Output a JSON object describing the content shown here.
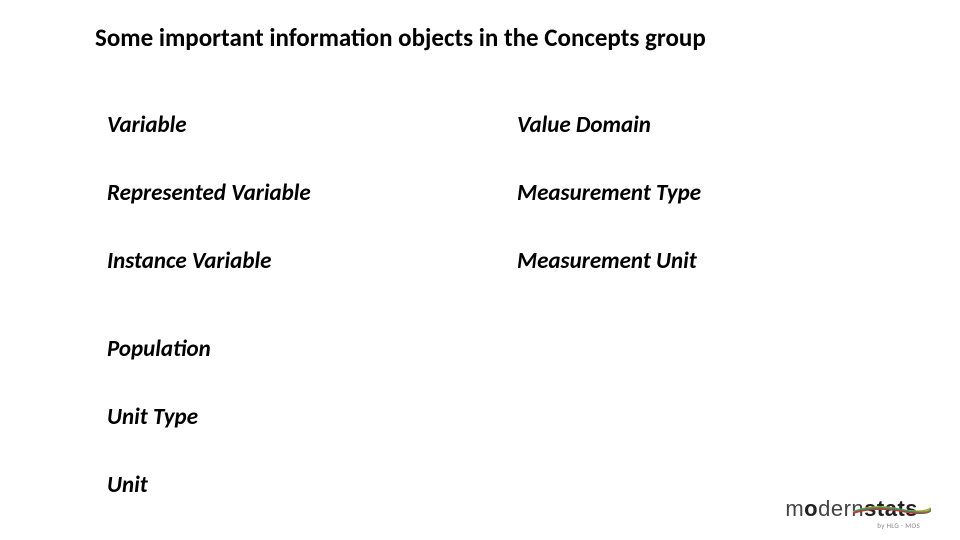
{
  "title": "Some important information objects in the Concepts group",
  "grid": {
    "r1c1": "Variable",
    "r1c2": "Value Domain",
    "r2c1": "Represented Variable",
    "r2c2": "Measurement Type",
    "r3c1": "Instance Variable",
    "r3c2": "Measurement Unit"
  },
  "list": {
    "i1": "Population",
    "i2": "Unit Type",
    "i3": "Unit"
  },
  "logo": {
    "part1": "m",
    "part2": "o",
    "part3": "dern",
    "part4": "stats",
    "sub": "by HLG - MOS"
  }
}
